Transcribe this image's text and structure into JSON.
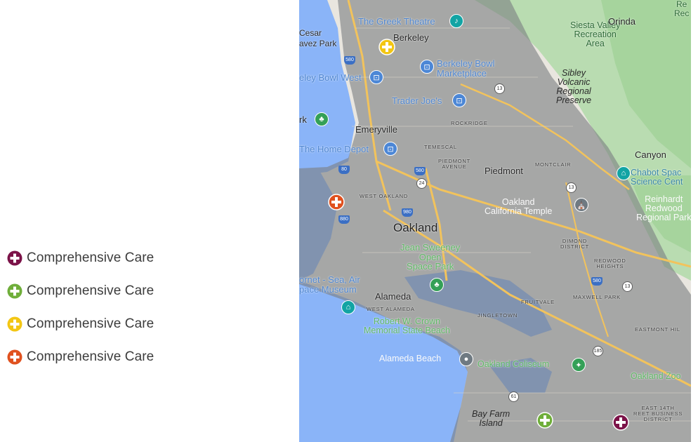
{
  "legend": {
    "items": [
      {
        "label": "Comprehensive Care",
        "color": "#7b1248",
        "icon": "plus-circle-icon"
      },
      {
        "label": "Comprehensive Care",
        "color": "#6fae3a",
        "icon": "plus-circle-icon"
      },
      {
        "label": "Comprehensive Care",
        "color": "#f3c613",
        "icon": "plus-circle-icon"
      },
      {
        "label": "Comprehensive Care",
        "color": "#e0511e",
        "icon": "plus-circle-icon"
      }
    ]
  },
  "map": {
    "labels": {
      "greek_theatre": "The Greek Theatre",
      "berkeley": "Berkeley",
      "cesar": "Cesar",
      "avez_park": "avez Park",
      "siesta": "Siesta Valley",
      "recreation": "Recreation",
      "area": "Area",
      "orinda": "Orinda",
      "re": "Re",
      "rec": "Rec",
      "berkeley_bowl": "Berkeley Bowl",
      "marketplace": "Marketplace",
      "eley_bowl_west": "eley Bowl West",
      "sibley": "Sibley",
      "volcanic": "Volcanic",
      "regional": "Regional",
      "preserve": "Preserve",
      "trader_joes": "Trader Joe's",
      "rk": "rk",
      "rockridge": "ROCKRIDGE",
      "emeryville": "Emeryville",
      "home_depot": "The Home Depot",
      "temescal": "TEMESCAL",
      "canyon": "Canyon",
      "piedmont_avenue_1": "PIEDMONT",
      "piedmont_avenue_2": "AVENUE",
      "piedmont": "Piedmont",
      "montclair": "MONTCLAIR",
      "chabot_1": "Chabot Spac",
      "chabot_2": "Science Cent",
      "west_oakland": "WEST OAKLAND",
      "oakland_temple_1": "Oakland",
      "oakland_temple_2": "California Temple",
      "reinhardt_1": "Reinhardt",
      "reinhardt_2": "Redwood",
      "reinhardt_3": "Regional Park",
      "oakland": "Oakland",
      "jean_1": "Jean Sweeney",
      "jean_2": "Open",
      "jean_3": "Space Park",
      "dimond_1": "DIMOND",
      "dimond_2": "DISTRICT",
      "redwood_heights_1": "REDWOOD",
      "redwood_heights_2": "HEIGHTS",
      "hornet_1": "ornet - Sea, Air",
      "hornet_2": "pace Museum",
      "alameda": "Alameda",
      "fruitvale": "FRUITVALE",
      "maxwell_park": "MAXWELL PARK",
      "west_alameda": "WEST ALAMEDA",
      "jingletown": "JINGLETOWN",
      "crown_1": "Robert W. Crown",
      "crown_2": "Memorial State Beach",
      "eastmont": "EASTMONT HIL",
      "alameda_beach": "Alameda Beach",
      "coliseum": "Oakland Coliseum",
      "oakland_zoo": "Oakland Zoo",
      "bay_farm_1": "Bay Farm",
      "bay_farm_2": "Island",
      "east14_1": "EAST 14TH",
      "east14_2": "REET BUSINESS",
      "east14_3": "DISTRICT"
    },
    "shields": {
      "i580_top": "580",
      "i13_a": "13",
      "i80": "80",
      "i580_mid": "580",
      "i24": "24",
      "i980": "980",
      "i880": "880",
      "i13_b": "13",
      "i580_low": "580",
      "i13_c": "13",
      "i185": "185",
      "i61": "61"
    },
    "markers": {
      "berkeley": {
        "color": "#f3c613",
        "icon": "plus-circle-icon"
      },
      "west_oakland": {
        "color": "#e0511e",
        "icon": "plus-circle-icon"
      },
      "bay_farm": {
        "color": "#6fae3a",
        "icon": "plus-circle-icon"
      },
      "east_oakland": {
        "color": "#7b1248",
        "icon": "plus-circle-icon"
      }
    }
  }
}
